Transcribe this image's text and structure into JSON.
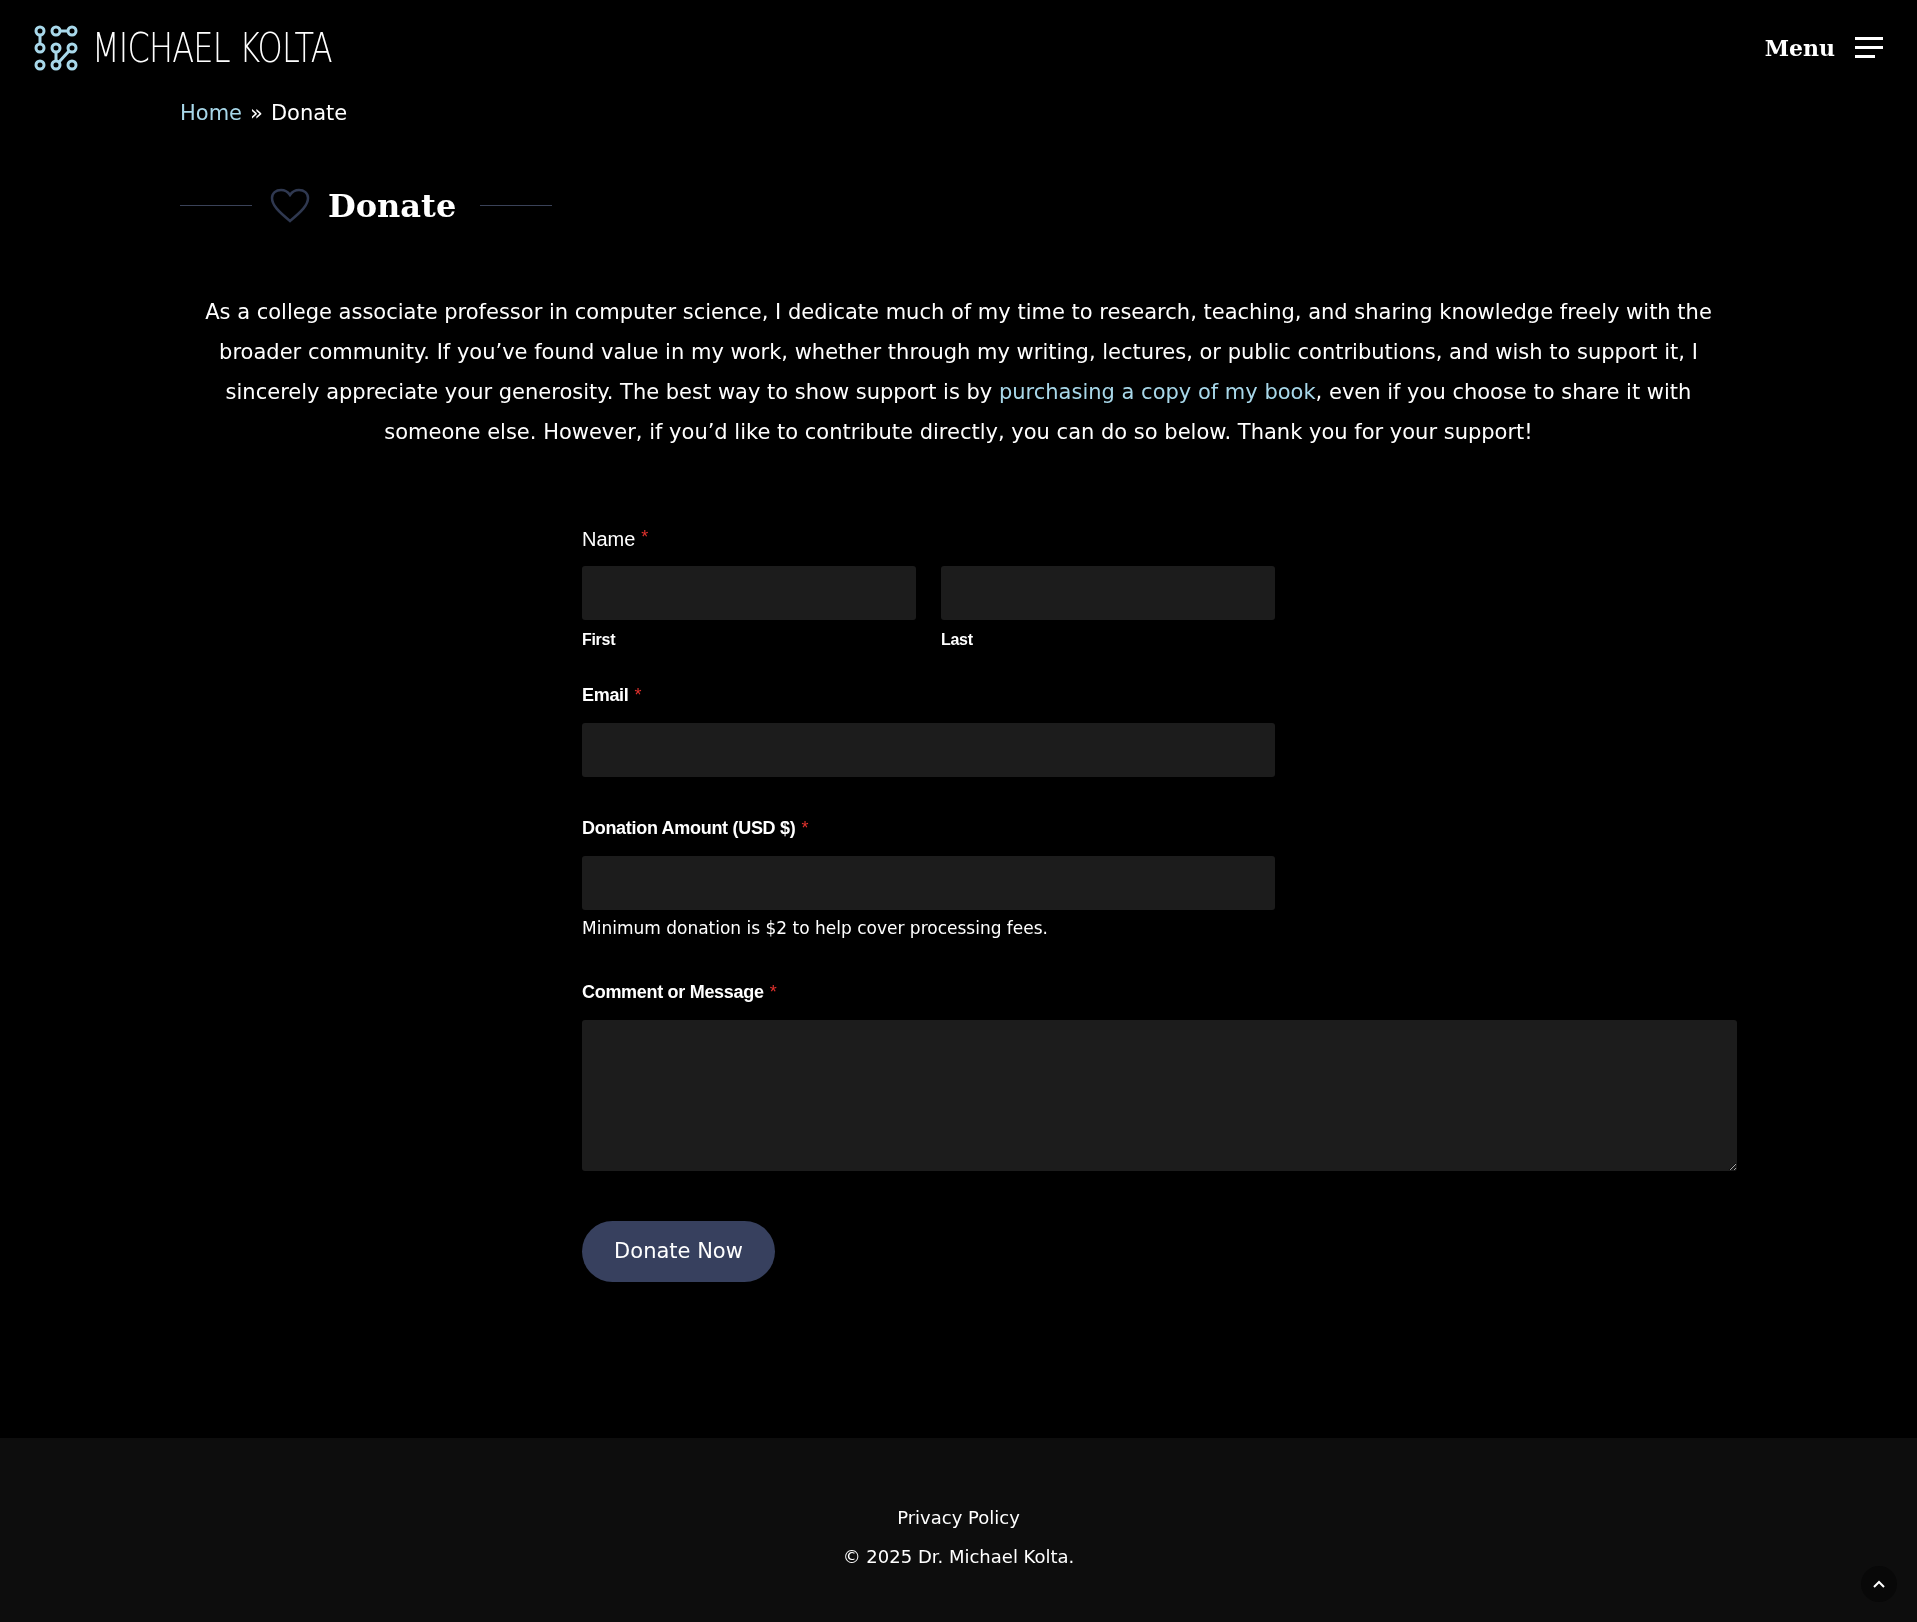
{
  "header": {
    "logo_text": "MICHAEL KOLTA",
    "menu_label": "Menu"
  },
  "breadcrumb": {
    "items": [
      {
        "label": "Home",
        "kind": "link"
      },
      {
        "label": "»",
        "kind": "separator"
      },
      {
        "label": "Donate",
        "kind": "current"
      }
    ]
  },
  "page_title": "Donate",
  "intro": {
    "before": "As a college associate professor in computer science, I dedicate much of my time to research, teaching, and sharing knowledge freely with the broader community. If you’ve found value in my work, whether through my writing, lectures, or public contributions, and wish to support it, I sincerely appreciate your generosity. The best way to show support is by ",
    "link": "purchasing a copy of my book",
    "after": ", even if you choose to share it with someone else. However, if you’d like to contribute directly, you can do so below. Thank you for your support!"
  },
  "form": {
    "name": {
      "label": "Name",
      "required_mark": "*",
      "sublabels": [
        "First",
        "Last"
      ]
    },
    "email": {
      "label": "Email",
      "required_mark": "*"
    },
    "amount": {
      "label": "Donation Amount (USD $)",
      "required_mark": "*",
      "hint": "Minimum donation is $2 to help cover processing fees."
    },
    "comment": {
      "label": "Comment or Message",
      "required_mark": "*"
    },
    "submit": "Donate Now"
  },
  "footer": {
    "links": [
      "Privacy Policy"
    ],
    "copyright": "© 2025 Dr. Michael Kolta."
  }
}
